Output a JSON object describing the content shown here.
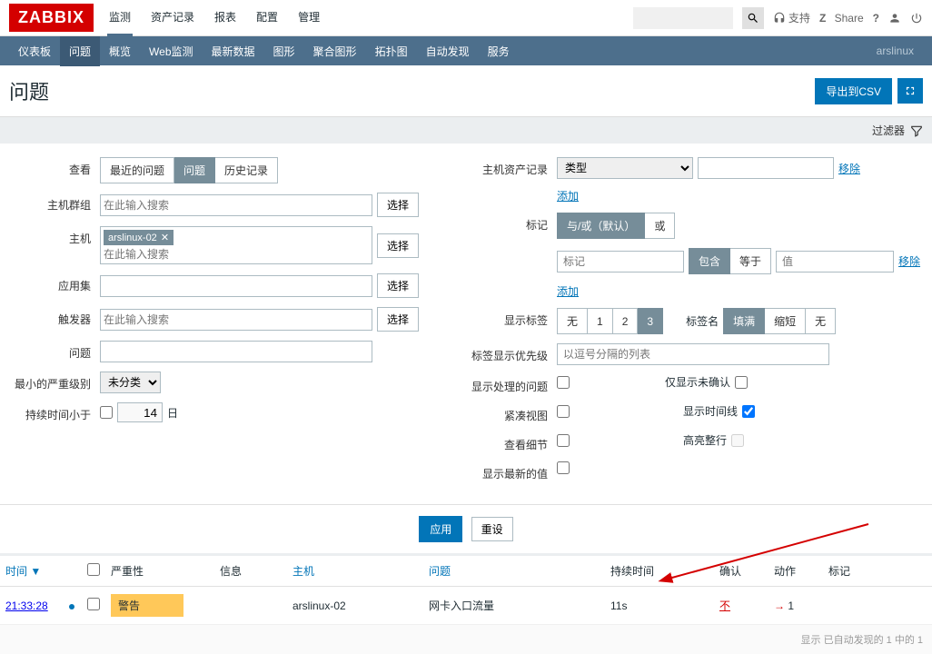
{
  "logo": "ZABBIX",
  "topnav": {
    "items": [
      "监测",
      "资产记录",
      "报表",
      "配置",
      "管理"
    ],
    "active": 0,
    "support": "支持",
    "share": "Share"
  },
  "subnav": {
    "items": [
      "仪表板",
      "问题",
      "概览",
      "Web监测",
      "最新数据",
      "图形",
      "聚合图形",
      "拓扑图",
      "自动发现",
      "服务"
    ],
    "active": 1,
    "user": "arslinux"
  },
  "page": {
    "title": "问题",
    "export_csv": "导出到CSV"
  },
  "filter_toggle": "过滤器",
  "filter": {
    "view_label": "查看",
    "view_opts": [
      "最近的问题",
      "问题",
      "历史记录"
    ],
    "hostgroup_label": "主机群组",
    "hostgroup_ph": "在此输入搜索",
    "host_label": "主机",
    "host_tag": "arslinux-02",
    "host_ph": "在此输入搜索",
    "app_label": "应用集",
    "trigger_label": "触发器",
    "trigger_ph": "在此输入搜索",
    "problem_label": "问题",
    "severity_label": "最小的严重级别",
    "severity_value": "未分类",
    "duration_label": "持续时间小于",
    "duration_value": "14",
    "duration_unit": "日",
    "select_btn": "选择",
    "inventory_label": "主机资产记录",
    "inventory_type": "类型",
    "add_link": "添加",
    "remove_link": "移除",
    "tags_label": "标记",
    "tags_andor": "与/或（默认）",
    "tags_or": "或",
    "tags_name_ph": "标记",
    "tags_contain": "包含",
    "tags_equal": "等于",
    "tags_value_ph": "值",
    "showtags_label": "显示标签",
    "showtags_opts": [
      "无",
      "1",
      "2",
      "3"
    ],
    "tagname_label": "标签名",
    "tagname_opts": [
      "填满",
      "缩短",
      "无"
    ],
    "tagprio_label": "标签显示优先级",
    "tagprio_ph": "以逗号分隔的列表",
    "showproc_label": "显示处理的问题",
    "unack_label": "仅显示未确认",
    "compact_label": "紧凑视图",
    "timeline_label": "显示时间线",
    "details_label": "查看细节",
    "highlight_label": "高亮整行",
    "latest_label": "显示最新的值",
    "apply": "应用",
    "reset": "重设"
  },
  "table": {
    "headers": {
      "time": "时间",
      "severity": "严重性",
      "info": "信息",
      "host": "主机",
      "problem": "问题",
      "duration": "持续时间",
      "ack": "确认",
      "actions": "动作",
      "tags": "标记"
    },
    "row": {
      "time": "21:33:28",
      "severity": "警告",
      "host": "arslinux-02",
      "problem": "网卡入口流量",
      "duration": "11s",
      "ack": "不",
      "actions": "1"
    },
    "footer": "显示 已自动发现的 1 中的 1"
  }
}
